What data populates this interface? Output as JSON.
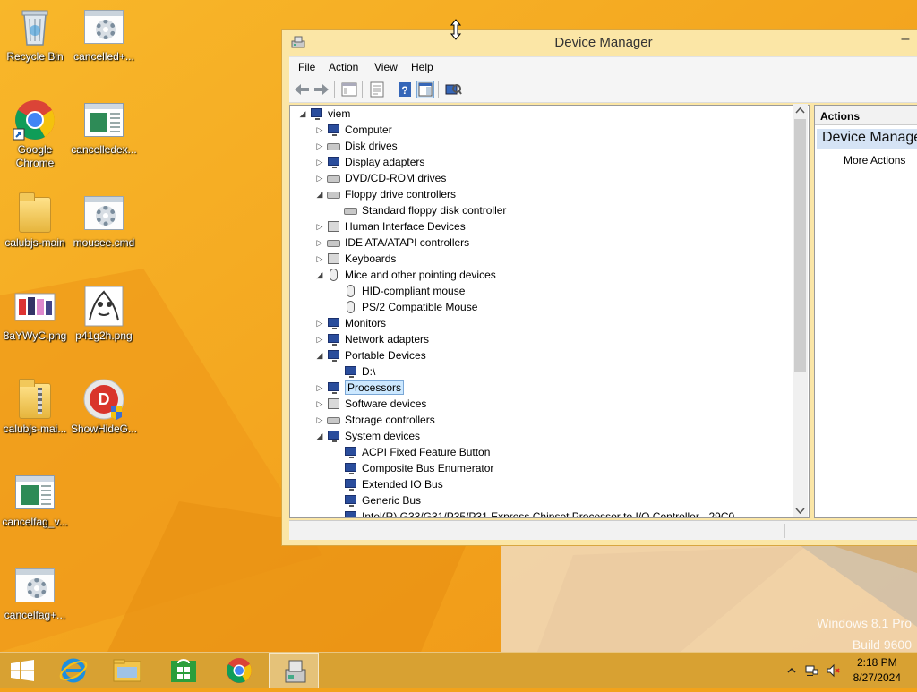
{
  "desktop": {
    "icons": [
      {
        "label": "Recycle Bin"
      },
      {
        "label": "cancelled+..."
      },
      {
        "label": "Google Chrome"
      },
      {
        "label": "cancelledex..."
      },
      {
        "label": "calubjs-main"
      },
      {
        "label": "mousee.cmd"
      },
      {
        "label": "8aYWyC.png"
      },
      {
        "label": "p41g2h.png"
      },
      {
        "label": "calubjs-mai..."
      },
      {
        "label": "ShowHideG..."
      },
      {
        "label": "cancelfag_v..."
      },
      {
        "label": "cancelfag+..."
      }
    ],
    "watermark": {
      "line1": "Windows 8.1 Pro",
      "line2": "Build 9600"
    }
  },
  "window": {
    "title": "Device Manager",
    "minimize_glyph": "–",
    "menu": [
      "File",
      "Action",
      "View",
      "Help"
    ],
    "tree": [
      {
        "label": "viem",
        "expander": "◢",
        "icon": "computer-icon"
      },
      {
        "label": "Computer",
        "expander": "▷",
        "icon": "monitor-icon"
      },
      {
        "label": "Disk drives",
        "expander": "▷",
        "icon": "drive-icon"
      },
      {
        "label": "Display adapters",
        "expander": "▷",
        "icon": "monitor-icon"
      },
      {
        "label": "DVD/CD-ROM drives",
        "expander": "▷",
        "icon": "drive-icon"
      },
      {
        "label": "Floppy drive controllers",
        "expander": "◢",
        "icon": "drive-icon"
      },
      {
        "label": "Standard floppy disk controller",
        "expander": "",
        "icon": "drive-icon"
      },
      {
        "label": "Human Interface Devices",
        "expander": "▷",
        "icon": "hid-icon"
      },
      {
        "label": "IDE ATA/ATAPI controllers",
        "expander": "▷",
        "icon": "drive-icon"
      },
      {
        "label": "Keyboards",
        "expander": "▷",
        "icon": "keyboard-icon"
      },
      {
        "label": "Mice and other pointing devices",
        "expander": "◢",
        "icon": "mouse-icon"
      },
      {
        "label": "HID-compliant mouse",
        "expander": "",
        "icon": "mouse-icon"
      },
      {
        "label": "PS/2 Compatible Mouse",
        "expander": "",
        "icon": "mouse-icon"
      },
      {
        "label": "Monitors",
        "expander": "▷",
        "icon": "monitor-icon"
      },
      {
        "label": "Network adapters",
        "expander": "▷",
        "icon": "network-icon"
      },
      {
        "label": "Portable Devices",
        "expander": "◢",
        "icon": "portable-icon"
      },
      {
        "label": "D:\\",
        "expander": "",
        "icon": "portable-icon"
      },
      {
        "label": "Processors",
        "expander": "▷",
        "icon": "processor-icon",
        "selected": true
      },
      {
        "label": "Software devices",
        "expander": "▷",
        "icon": "software-icon"
      },
      {
        "label": "Storage controllers",
        "expander": "▷",
        "icon": "storage-icon"
      },
      {
        "label": "System devices",
        "expander": "◢",
        "icon": "monitor-icon"
      },
      {
        "label": "ACPI Fixed Feature Button",
        "expander": "",
        "icon": "monitor-icon"
      },
      {
        "label": "Composite Bus Enumerator",
        "expander": "",
        "icon": "monitor-icon"
      },
      {
        "label": "Extended IO Bus",
        "expander": "",
        "icon": "monitor-icon"
      },
      {
        "label": "Generic Bus",
        "expander": "",
        "icon": "monitor-icon"
      },
      {
        "label": "Intel(R) G33/G31/P35/P31 Express Chipset Processor to I/O Controller - 29C0",
        "expander": "",
        "icon": "monitor-icon"
      }
    ],
    "actions": {
      "header": "Actions",
      "section": "Device Manager",
      "item": "More Actions"
    }
  },
  "taskbar": {
    "clock_time": "2:18 PM",
    "clock_date": "8/27/2024"
  }
}
